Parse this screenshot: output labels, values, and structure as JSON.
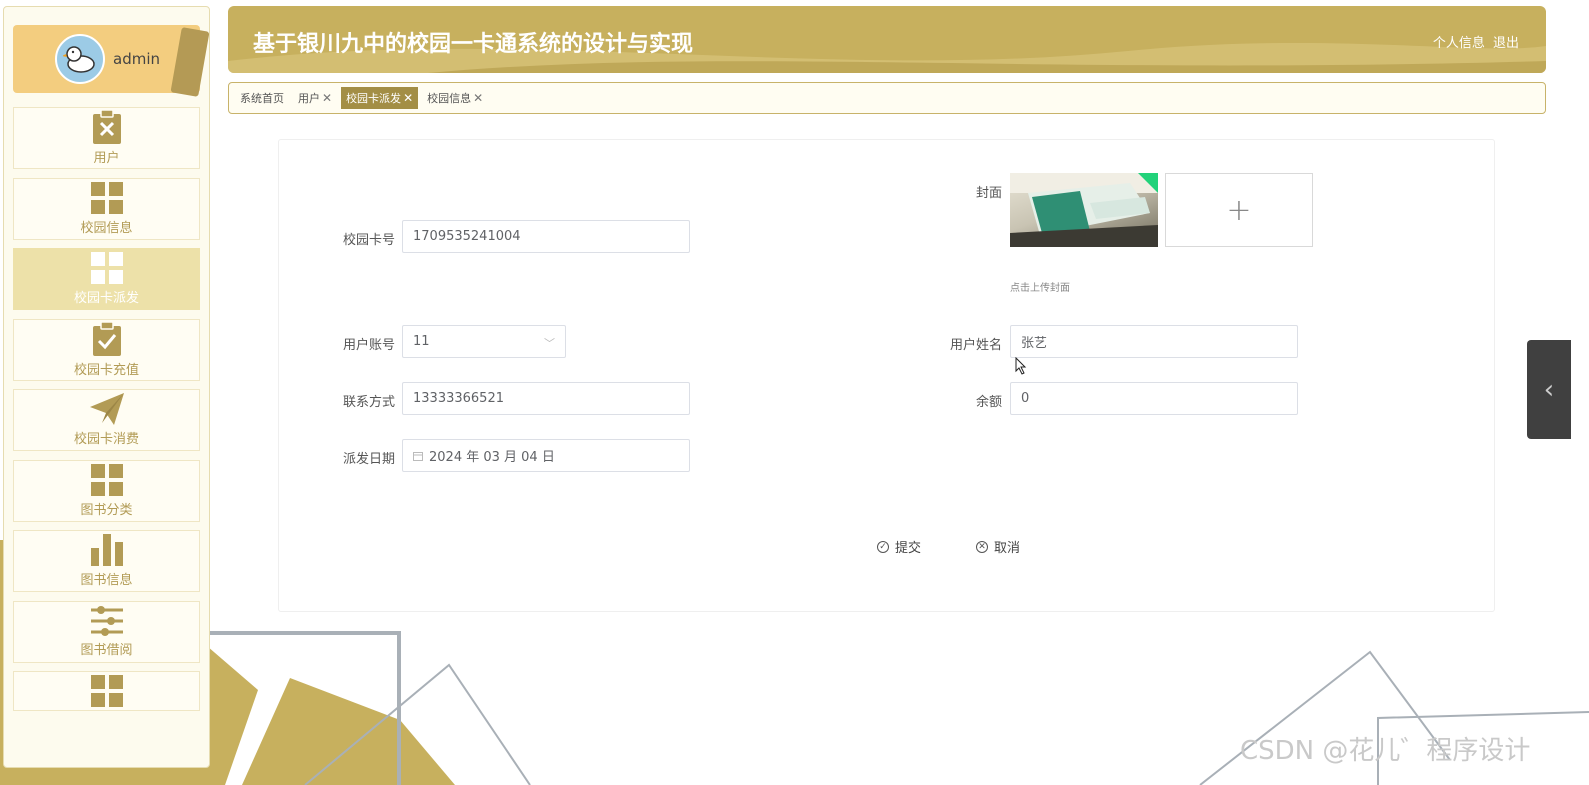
{
  "header": {
    "title": "基于银川九中的校园一卡通系统的设计与实现",
    "profile_link": "个人信息",
    "logout_link": "退出"
  },
  "user": {
    "name": "admin"
  },
  "sidebar": {
    "items": [
      {
        "label": "用户",
        "icon": "clipboard-x-icon",
        "active": false
      },
      {
        "label": "校园信息",
        "icon": "grid-icon",
        "active": false
      },
      {
        "label": "校园卡派发",
        "icon": "grid-icon",
        "active": true
      },
      {
        "label": "校园卡充值",
        "icon": "clipboard-check-icon",
        "active": false
      },
      {
        "label": "校园卡消费",
        "icon": "paper-plane-icon",
        "active": false
      },
      {
        "label": "图书分类",
        "icon": "grid-icon",
        "active": false
      },
      {
        "label": "图书信息",
        "icon": "bar-chart-icon",
        "active": false
      },
      {
        "label": "图书借阅",
        "icon": "sliders-icon",
        "active": false
      },
      {
        "label": "",
        "icon": "grid-icon",
        "active": false
      }
    ]
  },
  "tabs": [
    {
      "label": "系统首页",
      "closable": false,
      "active": false
    },
    {
      "label": "用户",
      "closable": true,
      "active": false
    },
    {
      "label": "校园卡派发",
      "closable": true,
      "active": true
    },
    {
      "label": "校园信息",
      "closable": true,
      "active": false
    }
  ],
  "form": {
    "card_no": {
      "label": "校园卡号",
      "value": "1709535241004"
    },
    "cover": {
      "label": "封面",
      "upload_tip": "点击上传封面",
      "add_symbol": "+"
    },
    "account": {
      "label": "用户账号",
      "value": "11"
    },
    "name": {
      "label": "用户姓名",
      "value": "张艺"
    },
    "phone": {
      "label": "联系方式",
      "value": "13333366521"
    },
    "balance": {
      "label": "余额",
      "value": "0"
    },
    "date": {
      "label": "派发日期",
      "value": "2024 年 03 月 04 日"
    },
    "submit_label": "提交",
    "cancel_label": "取消"
  },
  "watermark": "CSDN @花儿゛程序设计",
  "colors": {
    "brand": "#c7b05e",
    "sidebar_text": "#b29b55",
    "active_tab": "#a38e45",
    "sidebar_active": "#ede1a9"
  }
}
